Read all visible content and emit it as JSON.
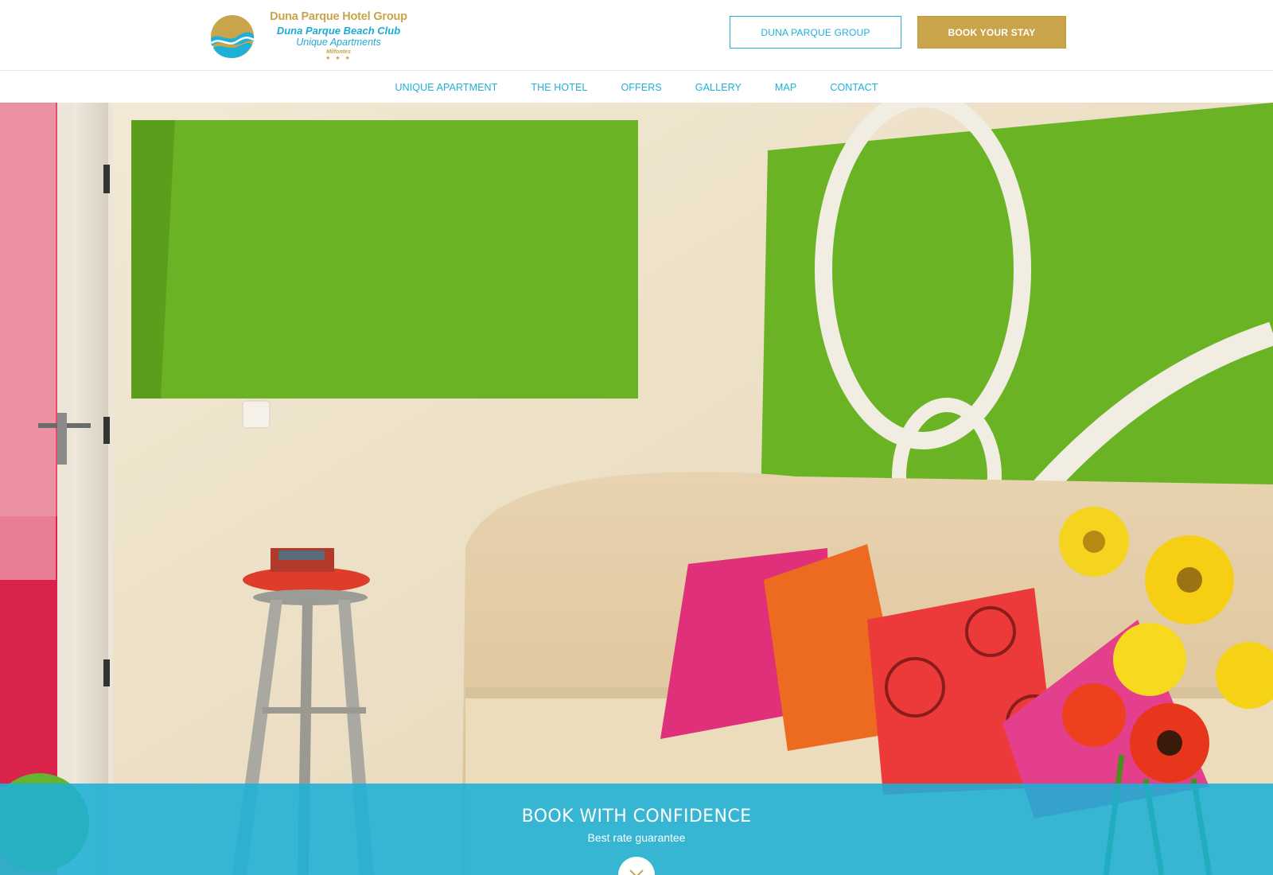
{
  "header": {
    "logo": {
      "group_name": "Duna Parque Hotel Group",
      "club_name": "Duna Parque Beach Club",
      "subtitle": "Unique Apartments",
      "location": "Milfontes",
      "stars": "★ ★ ★"
    },
    "group_button_label": "DUNA PARQUE GROUP",
    "book_button_label": "BOOK YOUR STAY"
  },
  "nav": {
    "items": [
      {
        "label": "UNIQUE APARTMENT"
      },
      {
        "label": "THE HOTEL"
      },
      {
        "label": "OFFERS"
      },
      {
        "label": "GALLERY"
      },
      {
        "label": "MAP"
      },
      {
        "label": "CONTACT"
      }
    ]
  },
  "banner": {
    "title": "BOOK WITH CONFIDENCE",
    "subtitle": "Best rate guarantee"
  },
  "colors": {
    "accent_blue": "#1fb0d8",
    "accent_gold": "#c9a44a",
    "banner_blue": "#1cb0d6"
  },
  "icons": {
    "scroll_down": "chevron-down-icon"
  }
}
